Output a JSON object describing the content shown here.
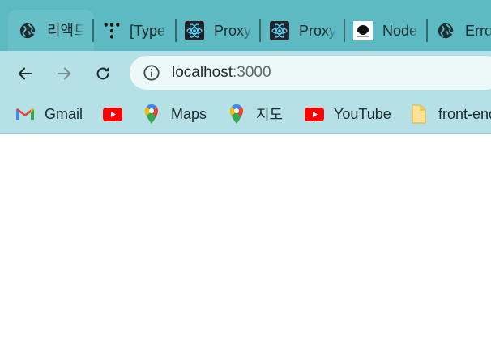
{
  "tabs": [
    {
      "label": "리액트",
      "icon": "globe-icon",
      "active": true
    },
    {
      "label": "[Type",
      "icon": "typeorm-icon"
    },
    {
      "label": "Proxy",
      "icon": "react-icon"
    },
    {
      "label": "Proxy",
      "icon": "react-icon"
    },
    {
      "label": "Node",
      "icon": "node-avatar-icon"
    },
    {
      "label": "Error",
      "icon": "globe-icon"
    }
  ],
  "toolbar": {
    "back": "back-arrow-icon",
    "forward": "forward-arrow-icon",
    "reload": "reload-icon",
    "url_host": "localhost",
    "url_port": ":3000"
  },
  "bookmarks": [
    {
      "label": "Gmail",
      "icon": "gmail-icon"
    },
    {
      "label": "",
      "icon": "youtube-icon"
    },
    {
      "label": "Maps",
      "icon": "maps-pin-icon"
    },
    {
      "label": "지도",
      "icon": "maps-pin-icon"
    },
    {
      "label": "YouTube",
      "icon": "youtube-icon"
    },
    {
      "label": "front-end",
      "icon": "folder-icon"
    }
  ],
  "colors": {
    "tabstrip": "#5db9c2",
    "toolbar": "#b5e1e6",
    "omnibox": "#edf8f9"
  }
}
